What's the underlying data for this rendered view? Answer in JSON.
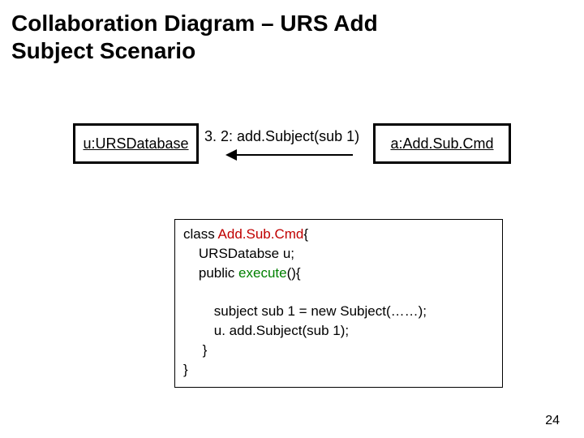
{
  "title": "Collaboration Diagram – URS Add Subject Scenario",
  "left_obj": "u:URSDatabase",
  "right_obj": "a:Add.Sub.Cmd",
  "message": "3. 2: add.Subject(sub 1)",
  "code": {
    "l1_a": "class ",
    "l1_b": "Add.Sub.Cmd",
    "l1_c": "{",
    "l2": "    URSDatabse u;",
    "l3_a": "    public ",
    "l3_b": "execute",
    "l3_c": "(){",
    "blank": " ",
    "l4": "        subject sub 1 = new Subject(……);",
    "l5": "        u. add.Subject(sub 1);",
    "l6": "     }",
    "l7": "}"
  },
  "page": "24"
}
